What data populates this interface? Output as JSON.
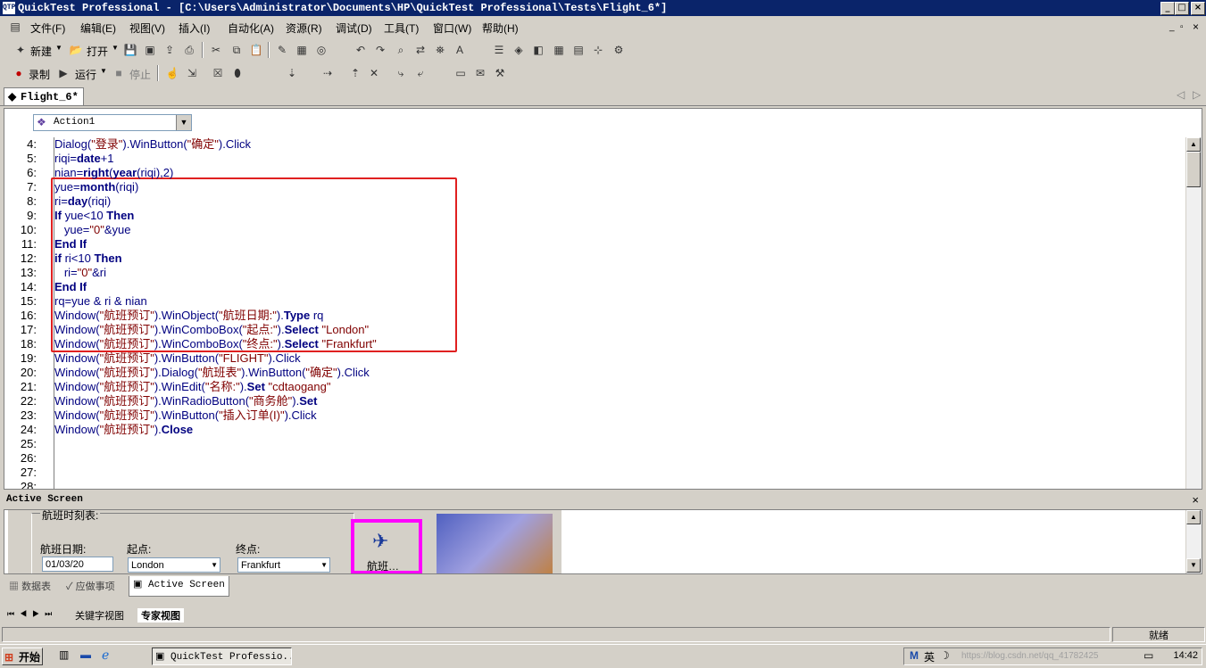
{
  "window": {
    "title": "QuickTest Professional - [C:\\Users\\Administrator\\Documents\\HP\\QuickTest Professional\\Tests\\Flight_6*]",
    "app_icon_text": "QTP"
  },
  "menubar": {
    "items": [
      "文件(F)",
      "编辑(E)",
      "视图(V)",
      "插入(I)",
      "自动化(A)",
      "资源(R)",
      "调试(D)",
      "工具(T)",
      "窗口(W)",
      "帮助(H)"
    ]
  },
  "toolbar1": {
    "new_label": "新建",
    "open_label": "打开"
  },
  "toolbar2": {
    "record_label": "录制",
    "run_label": "运行",
    "stop_label": "停止"
  },
  "document_tab": {
    "label": "Flight_6*"
  },
  "editor": {
    "action_selector": "Action1",
    "lines": [
      {
        "n": "4:",
        "parts": [
          [
            "t",
            "Dialog("
          ],
          [
            "s",
            "\"登录\""
          ],
          [
            "t",
            ").WinButton("
          ],
          [
            "s",
            "\"确定\""
          ],
          [
            "t",
            ").Click"
          ]
        ]
      },
      {
        "n": "5:",
        "parts": [
          [
            "t",
            "riqi="
          ],
          [
            "k",
            "date"
          ],
          [
            "t",
            "+1"
          ]
        ]
      },
      {
        "n": "6:",
        "parts": [
          [
            "t",
            "nian="
          ],
          [
            "k",
            "right"
          ],
          [
            "t",
            "("
          ],
          [
            "k",
            "year"
          ],
          [
            "t",
            "(riqi),2)"
          ]
        ]
      },
      {
        "n": "7:",
        "parts": [
          [
            "t",
            "yue="
          ],
          [
            "k",
            "month"
          ],
          [
            "t",
            "(riqi)"
          ]
        ]
      },
      {
        "n": "8:",
        "parts": [
          [
            "t",
            "ri="
          ],
          [
            "k",
            "day"
          ],
          [
            "t",
            "(riqi)"
          ]
        ]
      },
      {
        "n": "9:",
        "parts": [
          [
            "k",
            "If"
          ],
          [
            "t",
            " yue<10 "
          ],
          [
            "k",
            "Then"
          ]
        ]
      },
      {
        "n": "10:",
        "parts": [
          [
            "t",
            "   yue="
          ],
          [
            "s",
            "\"0\""
          ],
          [
            "t",
            "&yue"
          ]
        ]
      },
      {
        "n": "11:",
        "parts": [
          [
            "k",
            "End If"
          ]
        ]
      },
      {
        "n": "12:",
        "parts": [
          [
            "k",
            "if"
          ],
          [
            "t",
            " ri<10 "
          ],
          [
            "k",
            "Then"
          ]
        ]
      },
      {
        "n": "13:",
        "parts": [
          [
            "t",
            "   ri="
          ],
          [
            "s",
            "\"0\""
          ],
          [
            "t",
            "&ri"
          ]
        ]
      },
      {
        "n": "14:",
        "parts": [
          [
            "k",
            "End If"
          ]
        ]
      },
      {
        "n": "15:",
        "parts": [
          [
            "t",
            "rq=yue & ri & nian"
          ]
        ]
      },
      {
        "n": "16:",
        "parts": [
          [
            "t",
            "Window("
          ],
          [
            "s",
            "\"航班预订\""
          ],
          [
            "t",
            ").WinObject("
          ],
          [
            "s",
            "\"航班日期:\""
          ],
          [
            "t",
            ")."
          ],
          [
            "k",
            "Type"
          ],
          [
            "t",
            " rq"
          ]
        ]
      },
      {
        "n": "17:",
        "parts": [
          [
            "t",
            "Window("
          ],
          [
            "s",
            "\"航班预订\""
          ],
          [
            "t",
            ").WinComboBox("
          ],
          [
            "s",
            "\"起点:\""
          ],
          [
            "t",
            ")."
          ],
          [
            "k",
            "Select"
          ],
          [
            "t",
            " "
          ],
          [
            "s",
            "\"London\""
          ]
        ]
      },
      {
        "n": "18:",
        "parts": [
          [
            "t",
            "Window("
          ],
          [
            "s",
            "\"航班预订\""
          ],
          [
            "t",
            ").WinComboBox("
          ],
          [
            "s",
            "\"终点:\""
          ],
          [
            "t",
            ")."
          ],
          [
            "k",
            "Select"
          ],
          [
            "t",
            " "
          ],
          [
            "s",
            "\"Frankfurt\""
          ]
        ]
      },
      {
        "n": "19:",
        "parts": [
          [
            "t",
            "Window("
          ],
          [
            "s",
            "\"航班预订\""
          ],
          [
            "t",
            ").WinButton("
          ],
          [
            "s",
            "\"FLIGHT\""
          ],
          [
            "t",
            ").Click"
          ]
        ]
      },
      {
        "n": "20:",
        "parts": [
          [
            "t",
            "Window("
          ],
          [
            "s",
            "\"航班预订\""
          ],
          [
            "t",
            ").Dialog("
          ],
          [
            "s",
            "\"航班表\""
          ],
          [
            "t",
            ").WinButton("
          ],
          [
            "s",
            "\"确定\""
          ],
          [
            "t",
            ").Click"
          ]
        ]
      },
      {
        "n": "21:",
        "parts": [
          [
            "t",
            "Window("
          ],
          [
            "s",
            "\"航班预订\""
          ],
          [
            "t",
            ").WinEdit("
          ],
          [
            "s",
            "\"名称:\""
          ],
          [
            "t",
            ")."
          ],
          [
            "k",
            "Set"
          ],
          [
            "t",
            " "
          ],
          [
            "s",
            "\"cdtaogang\""
          ]
        ]
      },
      {
        "n": "22:",
        "parts": [
          [
            "t",
            "Window("
          ],
          [
            "s",
            "\"航班预订\""
          ],
          [
            "t",
            ").WinRadioButton("
          ],
          [
            "s",
            "\"商务舱\""
          ],
          [
            "t",
            ")."
          ],
          [
            "k",
            "Set"
          ]
        ]
      },
      {
        "n": "23:",
        "parts": [
          [
            "t",
            "Window("
          ],
          [
            "s",
            "\"航班预订\""
          ],
          [
            "t",
            ").WinButton("
          ],
          [
            "s",
            "\"插入订单(I)\""
          ],
          [
            "t",
            ").Click"
          ]
        ]
      },
      {
        "n": "24:",
        "parts": [
          [
            "t",
            "Window("
          ],
          [
            "s",
            "\"航班预订\""
          ],
          [
            "t",
            ")."
          ],
          [
            "k",
            "Close"
          ]
        ]
      },
      {
        "n": "25:",
        "parts": []
      },
      {
        "n": "26:",
        "parts": []
      },
      {
        "n": "27:",
        "parts": []
      },
      {
        "n": "28:",
        "parts": []
      }
    ]
  },
  "active_screen": {
    "title": "Active Screen",
    "group_label": "航班时刻表:",
    "date_label": "航班日期:",
    "date_value": "01/03/20",
    "from_label": "起点:",
    "from_value": "London",
    "to_label": "终点:",
    "to_value": "Frankfurt",
    "flight_button_label": "航班…"
  },
  "bottom_tabs": [
    "数据表",
    "应做事项",
    "Active Screen"
  ],
  "sheet_tabs": [
    "关键字视图",
    "专家视图"
  ],
  "statusbar": {
    "status": "就绪"
  },
  "taskbar": {
    "start_label": "开始",
    "task_label": "QuickTest Professio...",
    "clock": "14:42",
    "watermark": "https://blog.csdn.net/qq_41782425"
  },
  "colors": {
    "highlight": "#e02020",
    "title_bg": "#0a246a",
    "keyword": "#000080",
    "string": "#800000"
  }
}
